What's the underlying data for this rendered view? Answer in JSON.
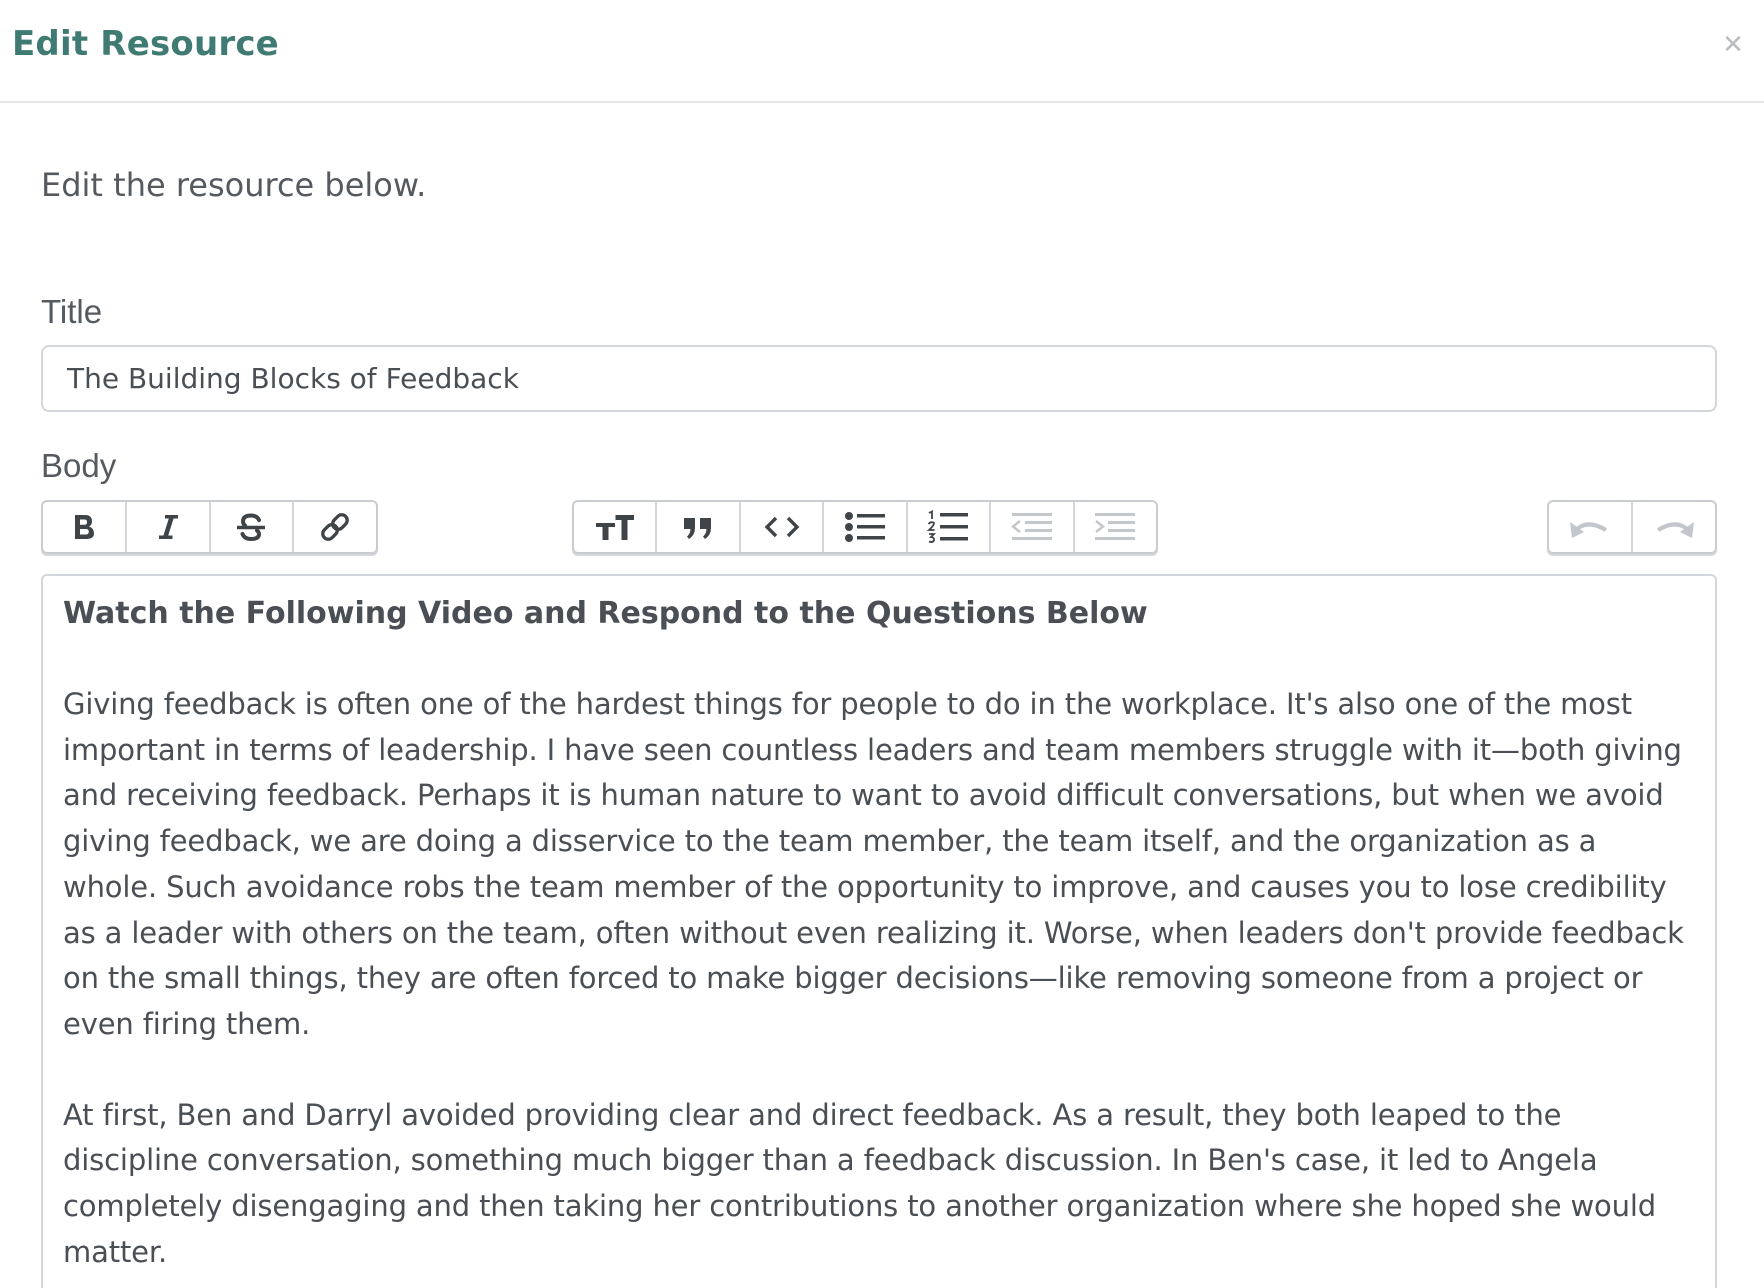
{
  "modal": {
    "title": "Edit Resource",
    "close_symbol": "✕",
    "intro": "Edit the resource below."
  },
  "form": {
    "title_label": "Title",
    "title_value": "The Building Blocks of Feedback",
    "body_label": "Body"
  },
  "toolbar": {
    "groups": [
      [
        "bold-icon",
        "italic-icon",
        "strikethrough-icon",
        "link-icon"
      ],
      [
        "heading-icon",
        "quote-icon",
        "code-icon",
        "bullet-list-icon",
        "numbered-list-icon",
        "outdent-icon",
        "indent-icon"
      ],
      [
        "undo-icon",
        "redo-icon"
      ]
    ],
    "disabled": [
      "outdent-icon",
      "indent-icon",
      "undo-icon",
      "redo-icon"
    ]
  },
  "editor": {
    "heading": "Watch the Following Video and Respond to the Questions Below",
    "paragraphs": [
      "Giving feedback is often one of the hardest things for people to do in the workplace. It's also one of the most important in terms of leadership. I have seen countless leaders and team members struggle with it—both giving and receiving feedback. Perhaps it is human nature to want to avoid difficult conversations, but when we avoid giving feedback, we are doing a disservice to the team member, the team itself, and the organization as a whole. Such avoidance robs the team member of the opportunity to improve, and causes you to lose credibility as a leader with others on the team, often without even realizing it. Worse, when leaders don't provide feedback on the small things, they are often forced to make bigger decisions—like removing someone from a project or even firing them.",
      "At first, Ben and Darryl avoided providing clear and direct feedback. As a result, they both leaped to the discipline conversation, something much bigger than a feedback discussion. In Ben's case, it led to Angela completely disengaging and then taking her contributions to another organization where she hoped she would matter."
    ]
  }
}
